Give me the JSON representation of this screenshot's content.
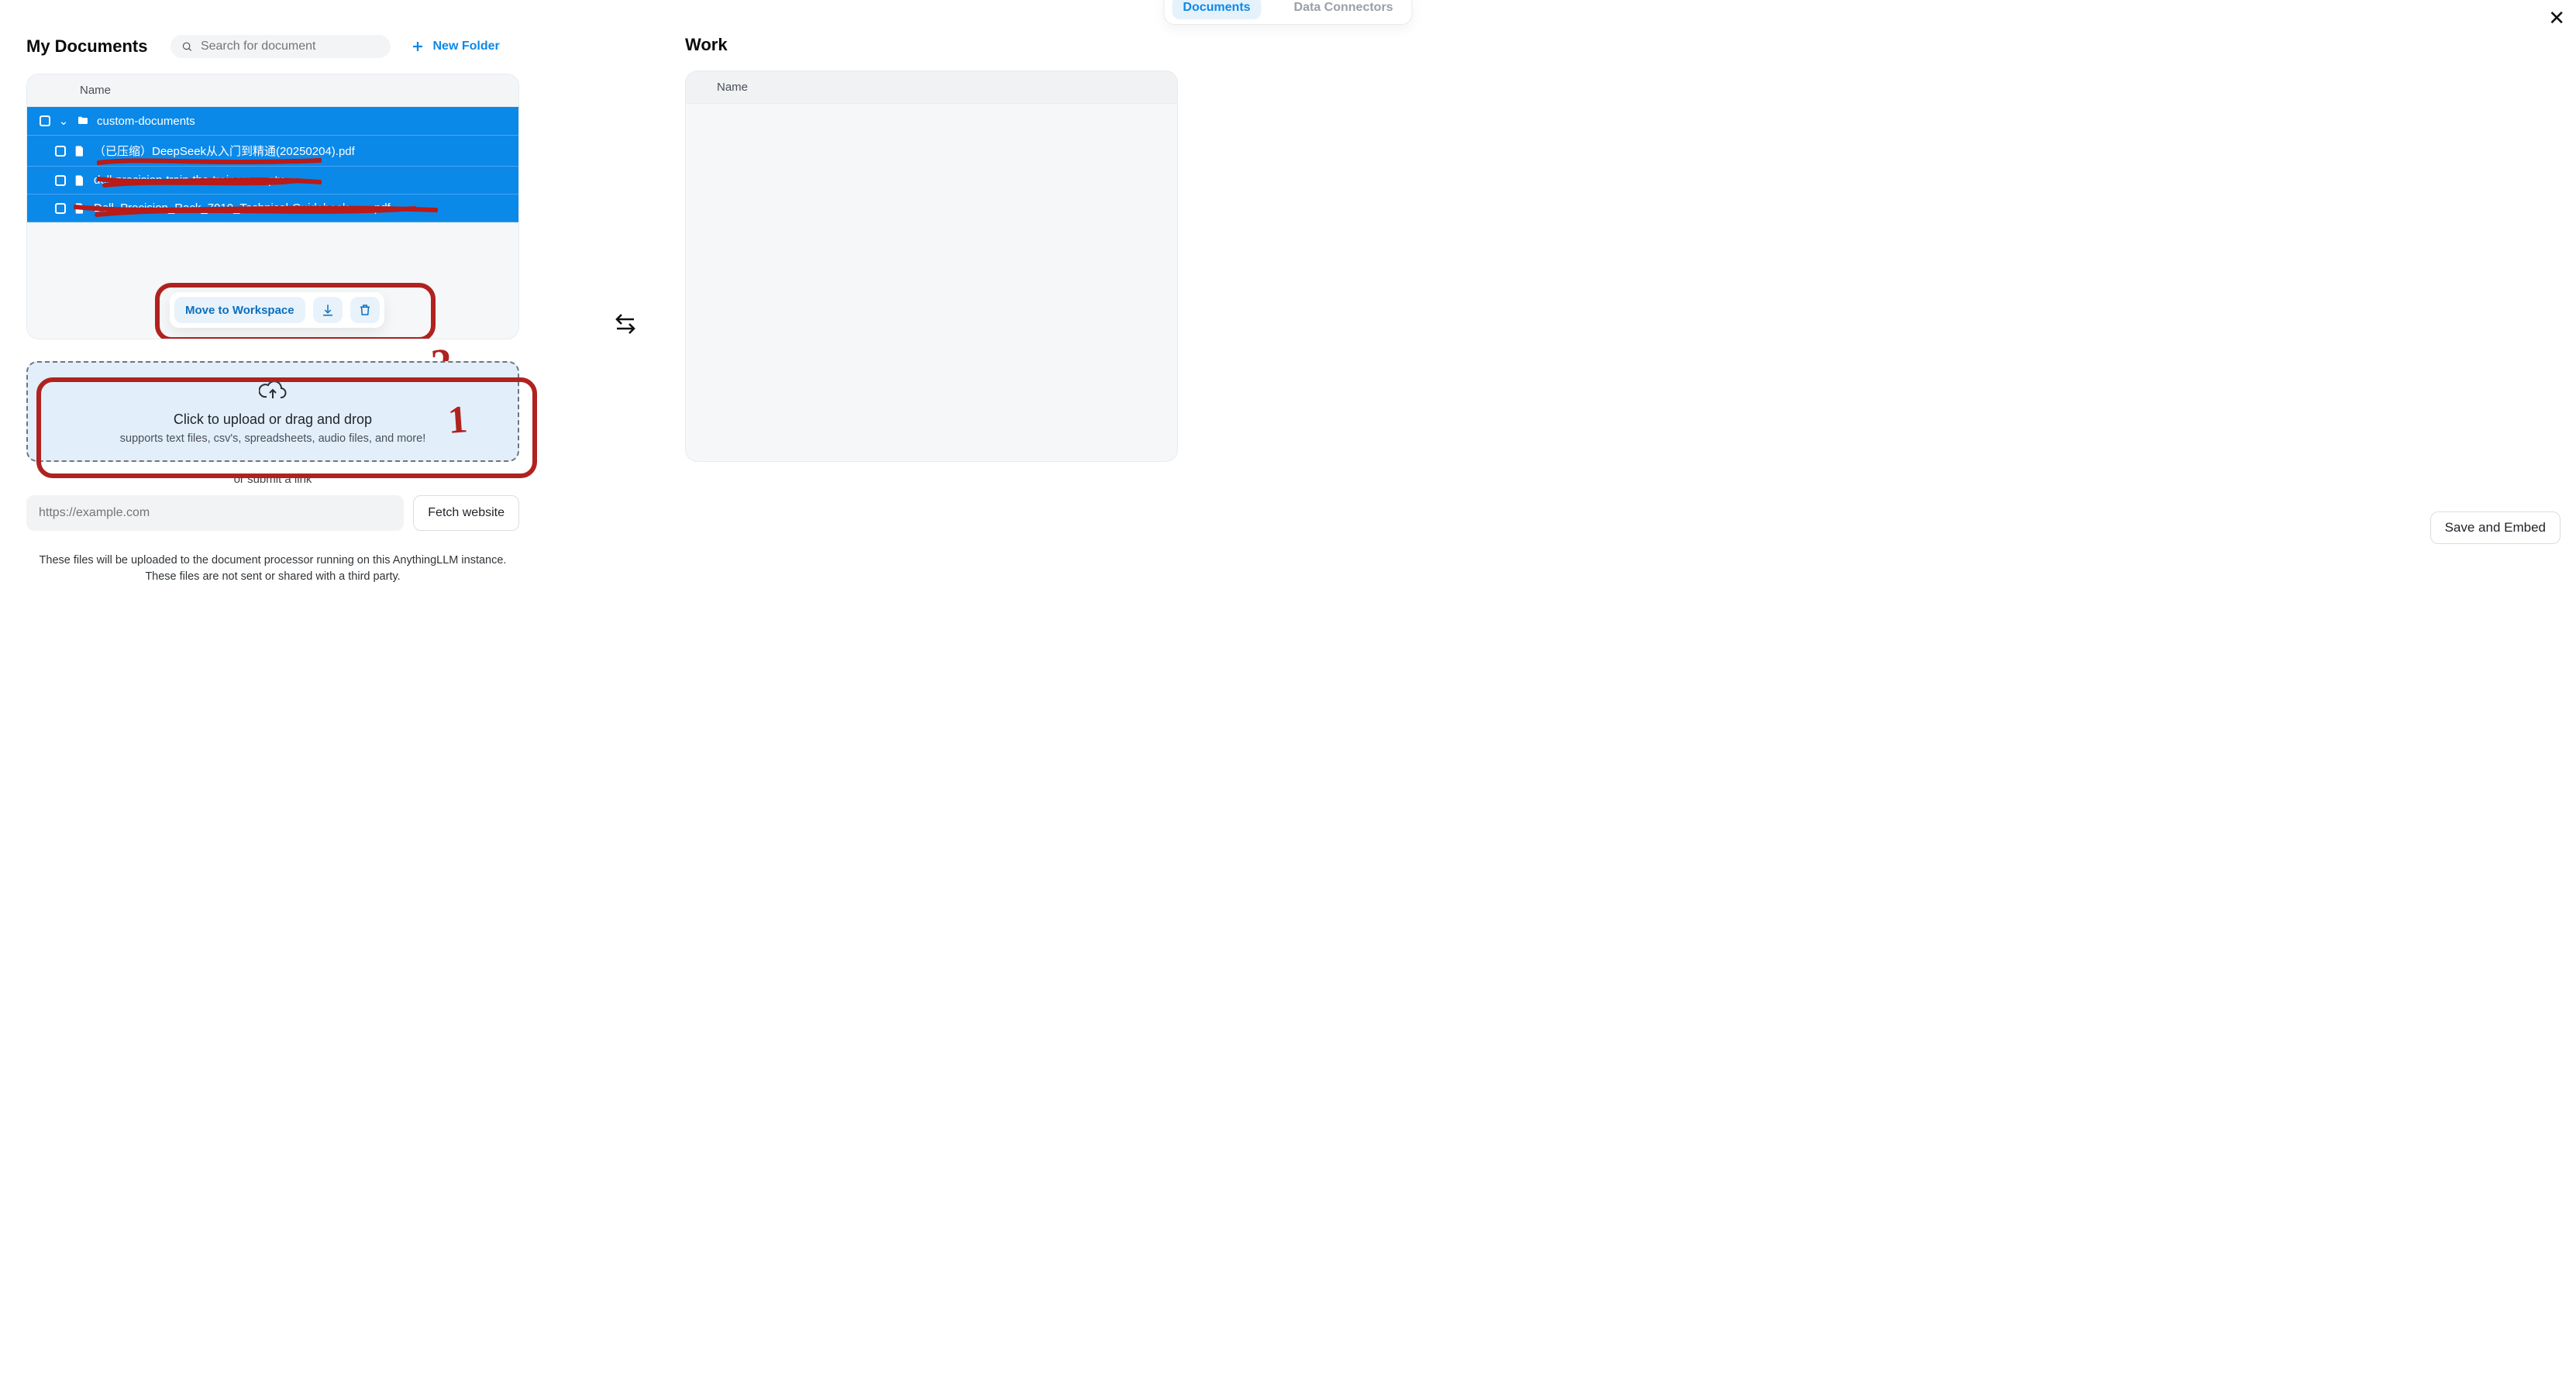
{
  "tabs": {
    "active": "Documents",
    "other": "Data Connectors"
  },
  "left": {
    "title": "My Documents",
    "search_placeholder": "Search for document",
    "new_folder_label": "New Folder",
    "name_header": "Name",
    "rows": [
      {
        "type": "folder",
        "label": "custom-documents"
      },
      {
        "type": "file",
        "label": "（已压缩）DeepSeek从入门到精通(20250204).pdf"
      },
      {
        "type": "file",
        "label": "dell-precision-train-the-trainers-....ptx"
      },
      {
        "type": "file",
        "label": "Dell_Precision_Rack_7910_Technical-Guidebook........pdf"
      }
    ],
    "actions": {
      "move": "Move to Workspace"
    },
    "upload": {
      "line1": "Click to upload or drag and drop",
      "line2": "supports text files, csv's, spreadsheets, audio files, and more!"
    },
    "or_label": "or submit a link",
    "link_placeholder": "https://example.com",
    "fetch_label": "Fetch website",
    "disclaimer_1": "These files will be uploaded to the document processor running on this AnythingLLM instance.",
    "disclaimer_2": "These files are not sent or shared with a third party."
  },
  "right": {
    "title": "Work",
    "name_header": "Name",
    "save_label": "Save and Embed"
  },
  "annotations": {
    "num_2": "2",
    "num_1": "1"
  }
}
